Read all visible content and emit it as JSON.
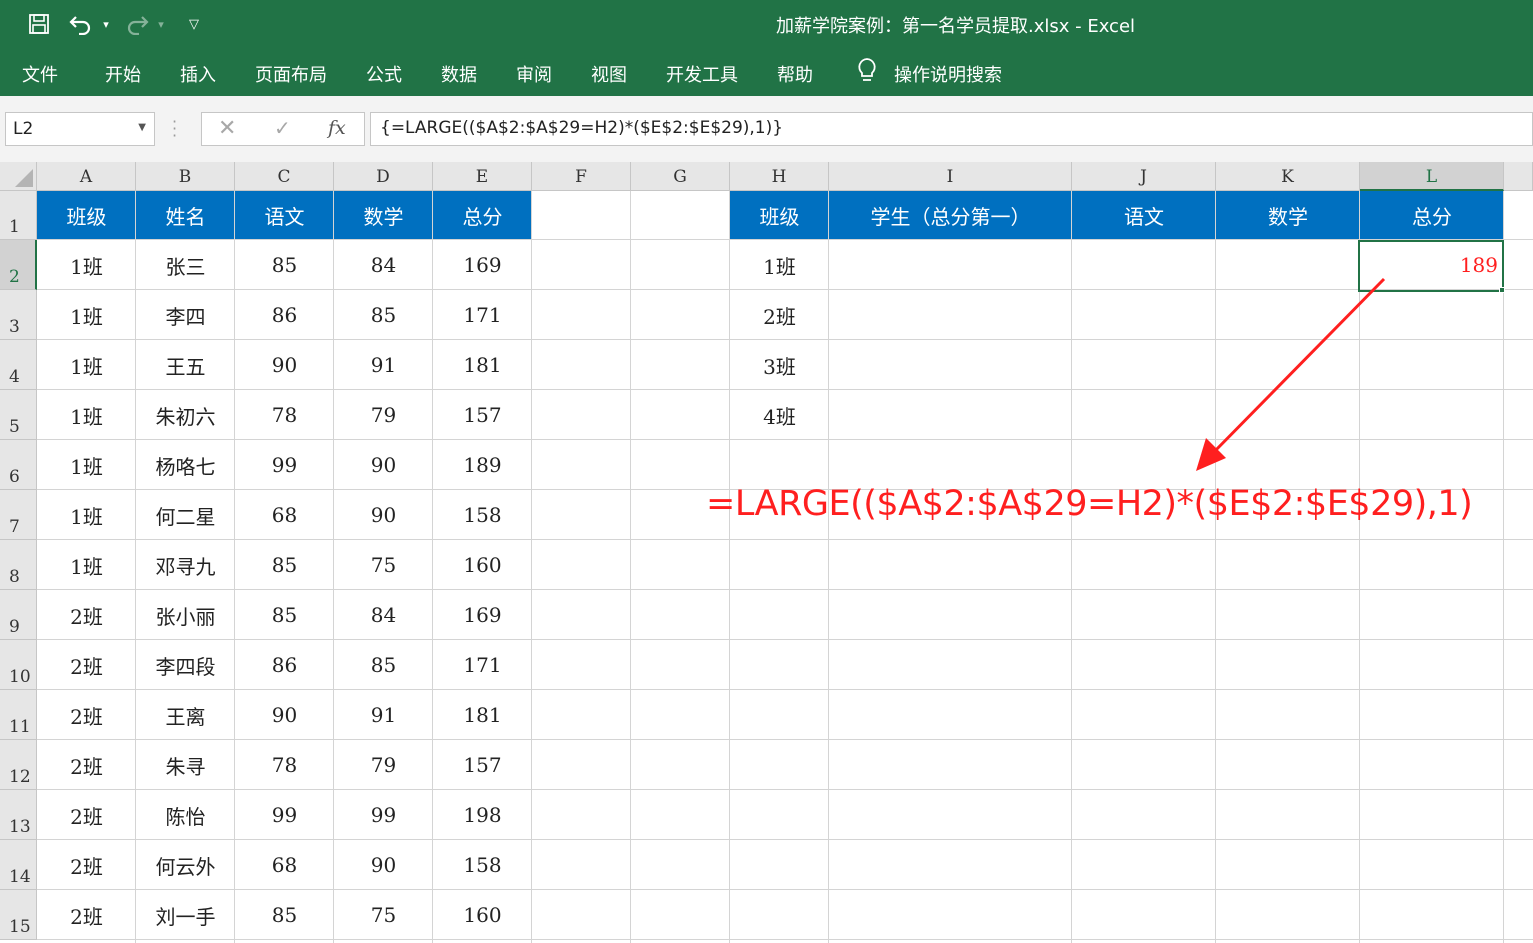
{
  "window": {
    "title": "加薪学院案例：第一名学员提取.xlsx  -  Excel"
  },
  "ribbon": {
    "tabs": [
      "文件",
      "开始",
      "插入",
      "页面布局",
      "公式",
      "数据",
      "审阅",
      "视图",
      "开发工具",
      "帮助",
      "操作说明搜索"
    ]
  },
  "formula_bar": {
    "name_box": "L2",
    "formula": "{=LARGE(($A$2:$A$29=H2)*($E$2:$E$29),1)}"
  },
  "sheet": {
    "columns": [
      "A",
      "B",
      "C",
      "D",
      "E",
      "F",
      "G",
      "H",
      "I",
      "J",
      "K",
      "L"
    ],
    "rows": [
      "1",
      "2",
      "3",
      "4",
      "5",
      "6",
      "7",
      "8",
      "9",
      "10",
      "11",
      "12",
      "13",
      "14",
      "15"
    ],
    "selected_column": "L",
    "selected_row": "2",
    "left_table": {
      "headers": [
        "班级",
        "姓名",
        "语文",
        "数学",
        "总分"
      ],
      "rows": [
        [
          "1班",
          "张三",
          "85",
          "84",
          "169"
        ],
        [
          "1班",
          "李四",
          "86",
          "85",
          "171"
        ],
        [
          "1班",
          "王五",
          "90",
          "91",
          "181"
        ],
        [
          "1班",
          "朱初六",
          "78",
          "79",
          "157"
        ],
        [
          "1班",
          "杨咯七",
          "99",
          "90",
          "189"
        ],
        [
          "1班",
          "何二星",
          "68",
          "90",
          "158"
        ],
        [
          "1班",
          "邓寻九",
          "85",
          "75",
          "160"
        ],
        [
          "2班",
          "张小丽",
          "85",
          "84",
          "169"
        ],
        [
          "2班",
          "李四段",
          "86",
          "85",
          "171"
        ],
        [
          "2班",
          "王离",
          "90",
          "91",
          "181"
        ],
        [
          "2班",
          "朱寻",
          "78",
          "79",
          "157"
        ],
        [
          "2班",
          "陈怡",
          "99",
          "99",
          "198"
        ],
        [
          "2班",
          "何云外",
          "68",
          "90",
          "158"
        ],
        [
          "2班",
          "刘一手",
          "85",
          "75",
          "160"
        ]
      ]
    },
    "right_table": {
      "headers": [
        "班级",
        "学生（总分第一）",
        "语文",
        "数学",
        "总分"
      ],
      "classes": [
        "1班",
        "2班",
        "3班",
        "4班"
      ],
      "result_value": "189"
    },
    "header_color": "#0070c0",
    "result_color": "#ff1f1f"
  },
  "annotation": {
    "text": "=LARGE(($A$2:$A$29=H2)*($E$2:$E$29),1)",
    "color": "#ff1f1f"
  }
}
